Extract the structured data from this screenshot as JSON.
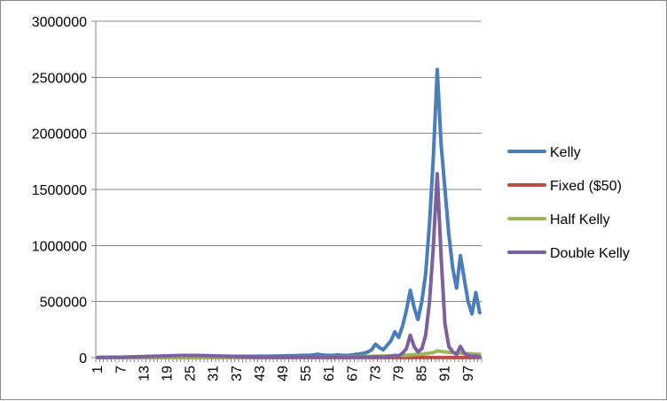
{
  "chart_data": {
    "type": "line",
    "title": "",
    "xlabel": "",
    "ylabel": "",
    "ylim": [
      0,
      3000000
    ],
    "y_ticks": [
      "0",
      "500000",
      "1000000",
      "1500000",
      "2000000",
      "2500000",
      "3000000"
    ],
    "y_tick_values": [
      0,
      500000,
      1000000,
      1500000,
      2000000,
      2500000,
      3000000
    ],
    "x": [
      1,
      2,
      3,
      4,
      5,
      6,
      7,
      8,
      9,
      10,
      11,
      12,
      13,
      14,
      15,
      16,
      17,
      18,
      19,
      20,
      21,
      22,
      23,
      24,
      25,
      26,
      27,
      28,
      29,
      30,
      31,
      32,
      33,
      34,
      35,
      36,
      37,
      38,
      39,
      40,
      41,
      42,
      43,
      44,
      45,
      46,
      47,
      48,
      49,
      50,
      51,
      52,
      53,
      54,
      55,
      56,
      57,
      58,
      59,
      60,
      61,
      62,
      63,
      64,
      65,
      66,
      67,
      68,
      69,
      70,
      71,
      72,
      73,
      74,
      75,
      76,
      77,
      78,
      79,
      80,
      81,
      82,
      83,
      84,
      85,
      86,
      87,
      88,
      89,
      90,
      91,
      92,
      93,
      94,
      95,
      96,
      97,
      98,
      99,
      100
    ],
    "x_tick_labels": [
      "1",
      "7",
      "13",
      "19",
      "25",
      "31",
      "37",
      "43",
      "49",
      "55",
      "61",
      "67",
      "73",
      "79",
      "85",
      "91",
      "97"
    ],
    "x_tick_values": [
      1,
      7,
      13,
      19,
      25,
      31,
      37,
      43,
      49,
      55,
      61,
      67,
      73,
      79,
      85,
      91,
      97
    ],
    "grid": true,
    "legend_position": "right",
    "series": [
      {
        "name": "Kelly",
        "color": "#4A7EBB",
        "values": [
          1000,
          1200,
          1500,
          1800,
          2000,
          2500,
          3000,
          3500,
          4000,
          5000,
          6000,
          7000,
          8000,
          9000,
          9500,
          10000,
          10500,
          11000,
          11500,
          12000,
          12500,
          13000,
          13500,
          14000,
          14500,
          15000,
          15000,
          15000,
          15000,
          14000,
          14000,
          14000,
          13000,
          13000,
          13000,
          12000,
          12000,
          12000,
          12000,
          12000,
          12000,
          12000,
          13000,
          13000,
          13000,
          14000,
          14000,
          15000,
          15000,
          16000,
          17000,
          18000,
          19000,
          20000,
          21000,
          22000,
          25000,
          30000,
          25000,
          22000,
          20000,
          20000,
          25000,
          22000,
          20000,
          20000,
          25000,
          30000,
          35000,
          40000,
          50000,
          70000,
          120000,
          90000,
          70000,
          110000,
          150000,
          230000,
          180000,
          280000,
          420000,
          600000,
          450000,
          340000,
          500000,
          750000,
          1200000,
          1800000,
          2570000,
          1900000,
          1500000,
          1100000,
          800000,
          620000,
          910000,
          700000,
          500000,
          390000,
          580000,
          400000
        ]
      },
      {
        "name": "Fixed ($50)",
        "color": "#BE4B48",
        "values": [
          1000,
          1000,
          1000,
          1000,
          1000,
          1000,
          1000,
          1000,
          1000,
          1000,
          1000,
          1000,
          1000,
          1000,
          1000,
          1000,
          1000,
          1000,
          1000,
          1000,
          1000,
          1000,
          1000,
          1000,
          1000,
          1000,
          1000,
          1000,
          1000,
          1000,
          1000,
          1000,
          1000,
          1000,
          1000,
          1000,
          1000,
          1000,
          1000,
          1000,
          1000,
          1000,
          1000,
          1000,
          1000,
          1000,
          1000,
          1000,
          1000,
          1000,
          1000,
          1000,
          1000,
          1000,
          1000,
          1000,
          1000,
          1000,
          1000,
          1000,
          1000,
          1000,
          1000,
          1000,
          1000,
          1000,
          1000,
          1000,
          1000,
          1000,
          1000,
          1000,
          1000,
          1000,
          1000,
          1000,
          1000,
          1000,
          1000,
          1000,
          1000,
          1000,
          1000,
          1000,
          1000,
          1000,
          1000,
          1000,
          1000,
          1000,
          1000,
          1000,
          1000,
          1000,
          1000,
          1000,
          1000,
          1000,
          1000,
          1000
        ]
      },
      {
        "name": "Half Kelly",
        "color": "#98B954",
        "values": [
          1000,
          1050,
          1100,
          1150,
          1200,
          1250,
          1300,
          1350,
          1400,
          1450,
          1500,
          1550,
          1600,
          1650,
          1700,
          1750,
          1800,
          1850,
          1900,
          1950,
          2000,
          2100,
          2200,
          2300,
          2400,
          2500,
          2600,
          2700,
          2800,
          2900,
          3000,
          3100,
          3200,
          3300,
          3400,
          3500,
          3600,
          3700,
          3800,
          3900,
          4000,
          4100,
          4200,
          4300,
          4400,
          4500,
          4600,
          4700,
          4800,
          4900,
          5000,
          5200,
          5400,
          5600,
          5800,
          6000,
          6200,
          6400,
          6600,
          6800,
          7000,
          7200,
          7400,
          7600,
          7800,
          8000,
          8500,
          9000,
          9500,
          10000,
          11000,
          12000,
          13000,
          14000,
          15000,
          16000,
          17000,
          18000,
          19000,
          20000,
          22000,
          25000,
          28000,
          30000,
          32000,
          35000,
          40000,
          45000,
          60000,
          55000,
          50000,
          48000,
          45000,
          42000,
          40000,
          38000,
          36000,
          34000,
          32000,
          30000
        ]
      },
      {
        "name": " Double Kelly",
        "color": "#7D60A0",
        "values": [
          1000,
          1500,
          2000,
          2500,
          3000,
          3500,
          4000,
          5000,
          6000,
          7000,
          8000,
          9000,
          10000,
          11000,
          12000,
          13000,
          14000,
          15000,
          16000,
          17000,
          18000,
          19000,
          20000,
          20000,
          20000,
          20000,
          20000,
          19000,
          18000,
          17000,
          16000,
          15000,
          14000,
          13000,
          12000,
          11000,
          10000,
          9000,
          8000,
          7000,
          6000,
          5000,
          5000,
          5000,
          5000,
          5000,
          5000,
          5000,
          5000,
          5000,
          5000,
          5000,
          5000,
          5000,
          5000,
          5000,
          5000,
          5000,
          5000,
          5000,
          5000,
          5000,
          5000,
          5000,
          5000,
          5000,
          5000,
          5000,
          5000,
          5000,
          5000,
          5000,
          8000,
          6000,
          5000,
          8000,
          12000,
          20000,
          15000,
          40000,
          80000,
          200000,
          100000,
          50000,
          80000,
          200000,
          500000,
          1000000,
          1640000,
          900000,
          300000,
          100000,
          50000,
          30000,
          100000,
          40000,
          20000,
          10000,
          15000,
          5000
        ]
      }
    ]
  }
}
